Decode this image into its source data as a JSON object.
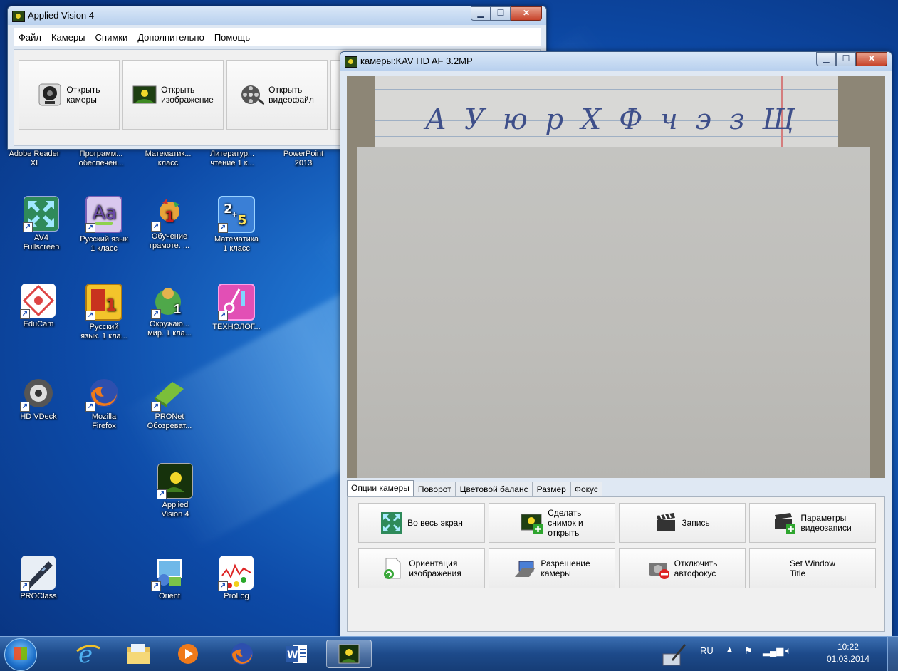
{
  "main_window": {
    "title": "Applied Vision 4",
    "menu": [
      "Файл",
      "Камеры",
      "Снимки",
      "Дополнительно",
      "Помощь"
    ],
    "toolbar": [
      {
        "label": "Открыть\nкамеры",
        "icon": "webcam-icon"
      },
      {
        "label": "Открыть\nизображение",
        "icon": "image-icon"
      },
      {
        "label": "Открыть\nвидеофайл",
        "icon": "film-reel-icon"
      }
    ]
  },
  "desktop_icons": [
    {
      "label": "Adobe Reader\nXI"
    },
    {
      "label": "Программ...\nобеспечен..."
    },
    {
      "label": "Математик...\nкласс"
    },
    {
      "label": "Литератур...\nчтение 1 к..."
    },
    {
      "label": "PowerPoint\n2013"
    },
    {
      "label": "AV4\nFullscreen",
      "icon": "fullscreen-arrows-icon"
    },
    {
      "label": "Русский язык\n1 класс",
      "icon": "letters-aa-icon"
    },
    {
      "label": "Обучение\nграмоте. ...",
      "icon": "rooster-icon"
    },
    {
      "label": "Математика\n1 класс",
      "icon": "math-numbers-icon"
    },
    {
      "label": "EduCam",
      "icon": "educam-icon"
    },
    {
      "label": "Русский\nязык. 1 кла...",
      "icon": "russian-book-icon"
    },
    {
      "label": "Окружаю...\nмир. 1 кла...",
      "icon": "globe-character-icon"
    },
    {
      "label": "ТЕХНОЛОГ...",
      "icon": "scissors-brush-icon"
    },
    {
      "label": "HD VDeck",
      "icon": "hd-vdeck-icon"
    },
    {
      "label": "Mozilla\nFirefox",
      "icon": "firefox-icon"
    },
    {
      "label": "PRONet\nОбозреват...",
      "icon": "green-book-icon"
    },
    {
      "label": "Applied\nVision 4",
      "icon": "applied-vision-icon"
    },
    {
      "label": "PROClass",
      "icon": "pen-device-icon"
    },
    {
      "label": "Orient",
      "icon": "orient-icon"
    },
    {
      "label": "ProLog",
      "icon": "prolog-graph-icon"
    }
  ],
  "camera_window": {
    "title": "камеры:KAV HD AF 3.2MP",
    "tabs": [
      "Опции камеры",
      "Поворот",
      "Цветовой баланс",
      "Размер",
      "Фокус"
    ],
    "active_tab": "Опции камеры",
    "buttons": [
      {
        "label": "Во весь экран",
        "icon": "fullscreen-icon"
      },
      {
        "label": "Сделать\nснимок и\nоткрыть",
        "icon": "snapshot-icon"
      },
      {
        "label": "Запись",
        "icon": "clapperboard-icon"
      },
      {
        "label": "Параметры\nвидеозаписи",
        "icon": "video-settings-icon"
      },
      {
        "label": "Ориентация\nизображения",
        "icon": "rotate-page-icon"
      },
      {
        "label": "Разрешение\nкамеры",
        "icon": "resolution-icon"
      },
      {
        "label": "Отключить\nавтофокус",
        "icon": "camera-no-af-icon"
      },
      {
        "label": "Set Window\nTitle",
        "icon": ""
      }
    ]
  },
  "taskbar": {
    "language": "RU",
    "time": "10:22",
    "date": "01.03.2014"
  }
}
